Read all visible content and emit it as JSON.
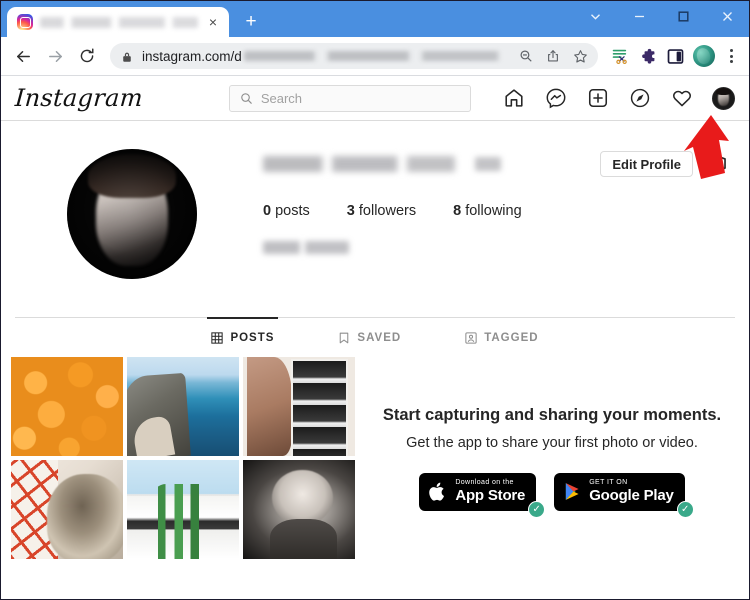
{
  "browser": {
    "tab": {
      "title": "",
      "title_redacted": true,
      "favicon": "instagram-favicon",
      "close_label": "×"
    },
    "new_tab_label": "+",
    "window_controls": [
      {
        "name": "tab-search",
        "icon": "chevron-down-icon"
      },
      {
        "name": "minimize",
        "icon": "minimize-icon"
      },
      {
        "name": "maximize",
        "icon": "maximize-icon"
      },
      {
        "name": "close",
        "icon": "close-icon"
      }
    ],
    "nav": {
      "back": "back-arrow-icon",
      "forward": "forward-arrow-icon",
      "reload": "reload-icon"
    },
    "omnibox": {
      "lock": "lock-icon",
      "url": "instagram.com/d",
      "url_redacted": true,
      "icons": [
        "zoom-out-icon",
        "share-icon",
        "bookmark-star-icon"
      ]
    },
    "toolbar_icons": [
      {
        "name": "clipboard-extension-icon"
      },
      {
        "name": "extensions-puzzle-icon"
      },
      {
        "name": "side-panel-icon"
      },
      {
        "name": "browser-profile-avatar"
      },
      {
        "name": "chrome-menu-icon"
      }
    ]
  },
  "instagram": {
    "logo": "Instagram",
    "search": {
      "placeholder": "Search",
      "value": "",
      "icon": "search-icon"
    },
    "nav_icons": [
      {
        "name": "home-icon"
      },
      {
        "name": "messenger-icon"
      },
      {
        "name": "new-post-icon"
      },
      {
        "name": "explore-compass-icon"
      },
      {
        "name": "activity-heart-icon"
      },
      {
        "name": "profile-avatar"
      }
    ],
    "profile": {
      "avatar": "profile-photo",
      "username": "",
      "username_redacted": true,
      "full_name": "",
      "full_name_redacted": true,
      "edit_button": "Edit Profile",
      "settings_icon": "gear-icon",
      "stats": [
        {
          "count": "0",
          "label": "posts"
        },
        {
          "count": "3",
          "label": "followers"
        },
        {
          "count": "8",
          "label": "following"
        }
      ]
    },
    "tabs": [
      {
        "label": "POSTS",
        "icon": "grid-icon",
        "active": true
      },
      {
        "label": "SAVED",
        "icon": "bookmark-icon",
        "active": false
      },
      {
        "label": "TAGGED",
        "icon": "tagged-person-icon",
        "active": false
      }
    ],
    "grid": [
      {
        "name": "post-oranges",
        "alt": "oranges"
      },
      {
        "name": "post-coastline",
        "alt": "coastal cliff and ocean"
      },
      {
        "name": "post-photobooth",
        "alt": "hand holding photobooth strip"
      },
      {
        "name": "post-dog",
        "alt": "shaggy dog on striped blanket"
      },
      {
        "name": "post-cactus",
        "alt": "cactus in front of white building"
      },
      {
        "name": "post-baby",
        "alt": "smiling baby in black and white"
      }
    ],
    "promo": {
      "heading": "Start capturing and sharing your moments.",
      "subheading": "Get the app to share your first photo or video.",
      "badges": [
        {
          "name": "app-store-badge",
          "sub": "Download on the",
          "main": "App Store",
          "icon": "apple-icon",
          "checked": true
        },
        {
          "name": "google-play-badge",
          "sub": "GET IT ON",
          "main": "Google Play",
          "icon": "google-play-icon",
          "checked": true
        }
      ],
      "check_glyph": "✓"
    }
  },
  "annotation": {
    "arrow": {
      "name": "red-pointer-arrow",
      "color": "#e81b1b",
      "points_to": "profile-avatar"
    }
  }
}
